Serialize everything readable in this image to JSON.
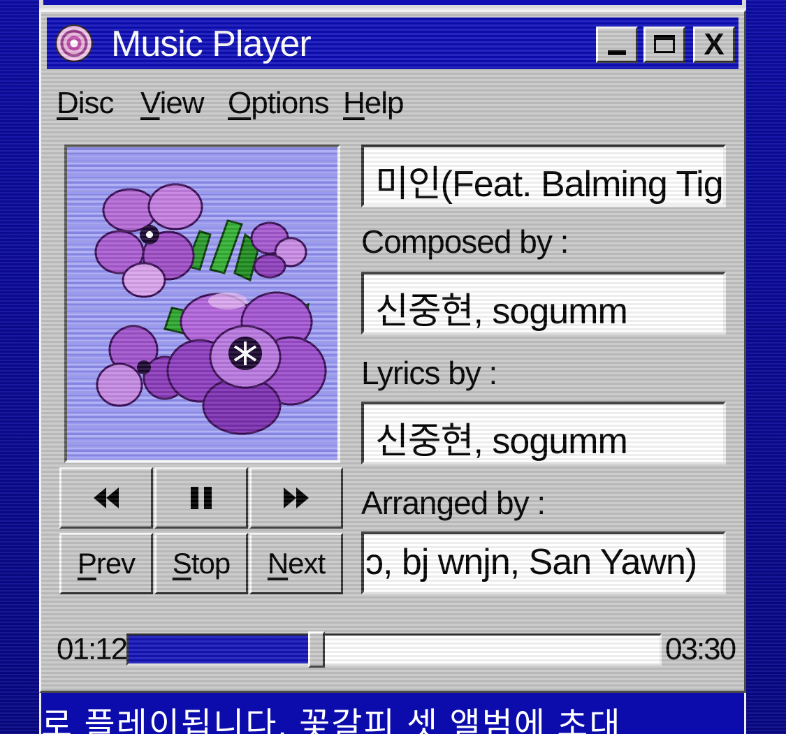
{
  "window": {
    "title": "Music Player",
    "minimize_glyph": "",
    "maximize_glyph": "",
    "close_glyph": "X"
  },
  "menu": [
    {
      "ul": "D",
      "rest": "isc"
    },
    {
      "ul": "V",
      "rest": "iew"
    },
    {
      "ul": "O",
      "rest": "ptions"
    },
    {
      "ul": "H",
      "rest": "elp"
    }
  ],
  "controls": {
    "rewind_icon": "rewind-icon",
    "pause_icon": "pause-icon",
    "fast_forward_icon": "fast-forward-icon",
    "prev": {
      "ul": "P",
      "rest": "rev"
    },
    "stop": {
      "ul": "S",
      "rest": "top"
    },
    "next": {
      "ul": "N",
      "rest": "ext"
    }
  },
  "track": {
    "title_display": "미인(Feat. Balming Tig",
    "composed_label": "Composed by :",
    "composed_value": "신중현, sogumm",
    "lyrics_label": "Lyrics by :",
    "lyrics_value": "신중현, sogumm",
    "arranged_label": "Arranged by :",
    "arranged_value": "ɔ, bj wnjn, San Yawn)"
  },
  "playback": {
    "elapsed": "01:12",
    "total": "03:30",
    "progress_fraction": 0.354
  },
  "marquee": {
    "text": "로 플레이됩니다.    꽃갈피 셋 앨범에 초대"
  },
  "colors": {
    "title_bar": "#0d0db7",
    "progress_fill": "#1414b8",
    "window_face": "#c6c6c6",
    "desktop": "#0a0a9e"
  }
}
